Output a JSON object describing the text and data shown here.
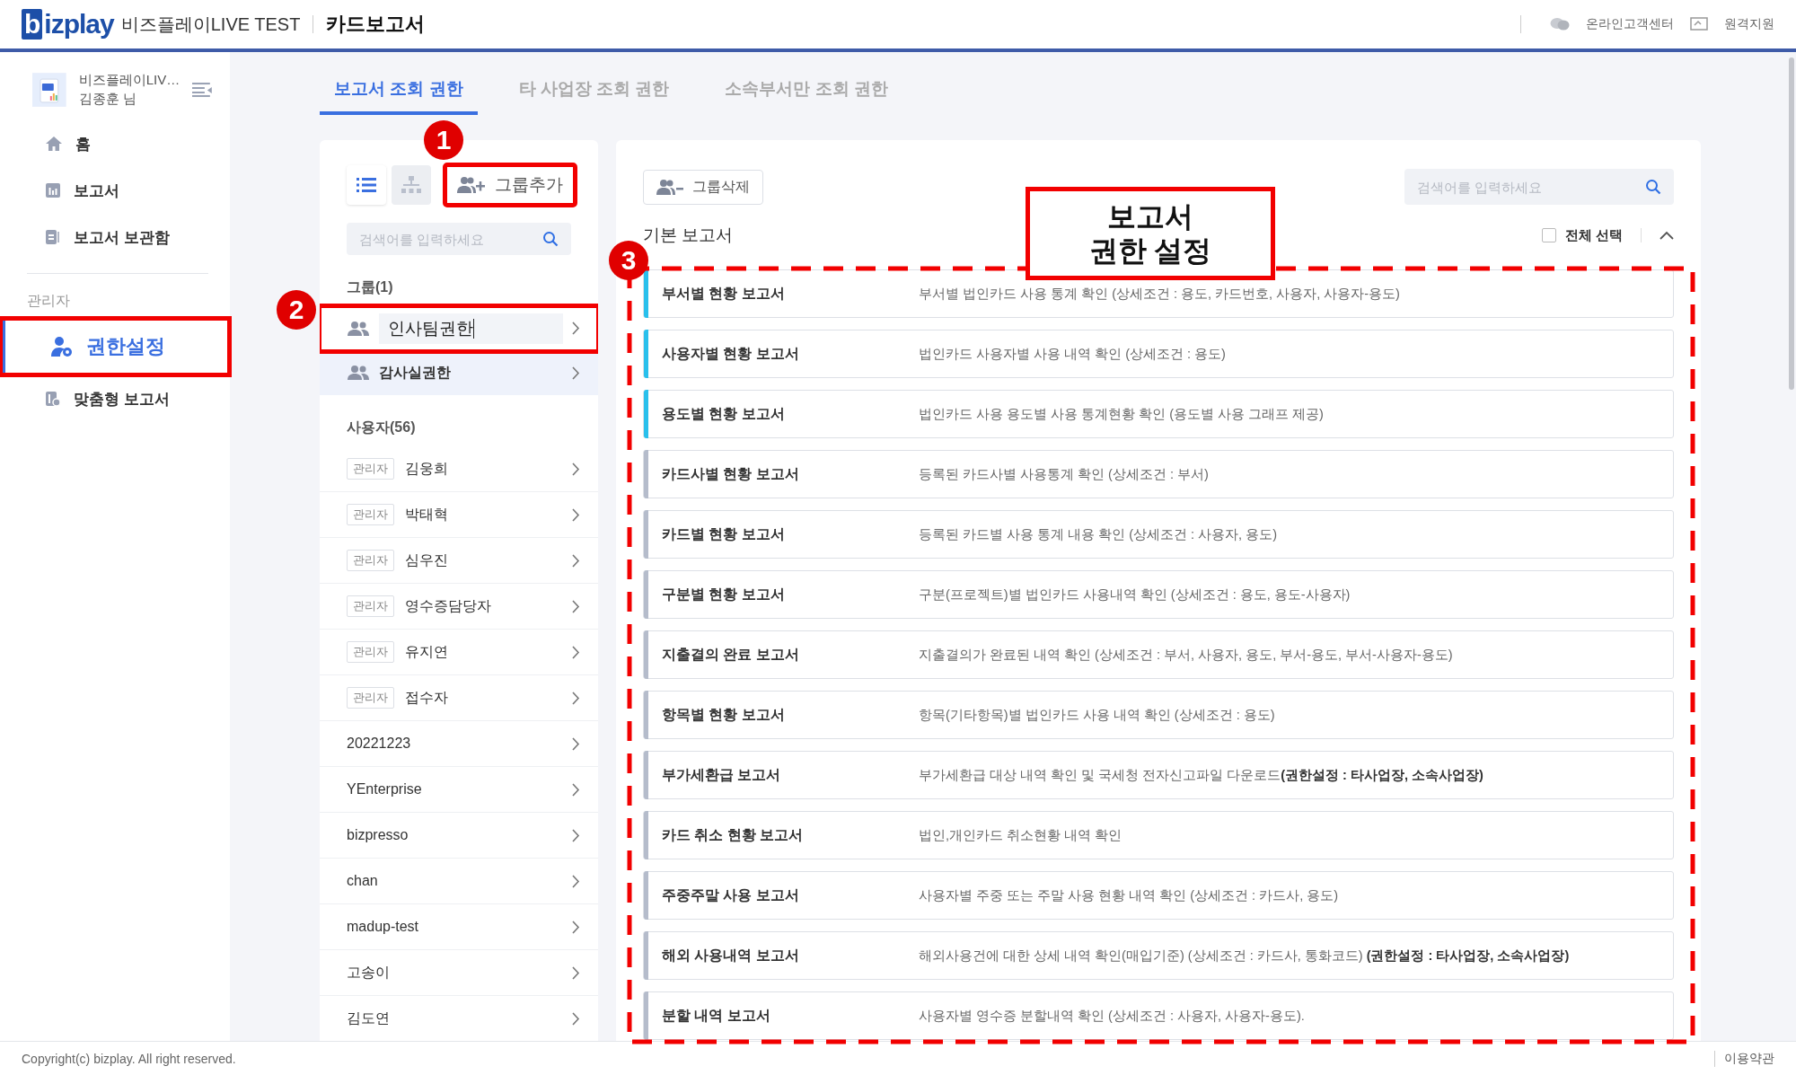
{
  "header": {
    "logo": "bizplay",
    "company": "비즈플레이LIVE TEST",
    "title": "카드보고서",
    "links": [
      {
        "kind": "chat",
        "label": "온라인고객센터"
      },
      {
        "kind": "remote",
        "label": "원격지원"
      }
    ]
  },
  "sidebar": {
    "profile": {
      "company": "비즈플레이LIV…",
      "user": "김종훈 님"
    },
    "items": [
      {
        "kind": "home",
        "label": "홈",
        "selected": false
      },
      {
        "kind": "chart",
        "label": "보고서",
        "selected": false
      },
      {
        "kind": "archive",
        "label": "보고서 보관함",
        "selected": false
      }
    ],
    "section": "관리자",
    "admin_items": [
      {
        "kind": "permission",
        "label": "권한설정",
        "selected": true,
        "annotated": true
      },
      {
        "kind": "custom",
        "label": "맞춤형 보고서",
        "selected": false
      }
    ]
  },
  "tabs": [
    {
      "label": "보고서 조회 권한",
      "selected": true
    },
    {
      "label": "타 사업장 조회 권한",
      "selected": false
    },
    {
      "label": "소속부서만 조회 권한",
      "selected": false
    }
  ],
  "left_panel": {
    "views": [
      {
        "kind": "list",
        "selected": true
      },
      {
        "kind": "tree",
        "selected": false
      }
    ],
    "add_button": {
      "label": "그룹추가",
      "annotated": true
    },
    "search": {
      "placeholder": "검색어를 입력하세요"
    },
    "groups_heading": "그룹(1)",
    "groups": [
      {
        "label": "인사팀권한",
        "editing": true,
        "selected": false,
        "annotated": true
      },
      {
        "label": "감사실권한",
        "editing": false,
        "selected": true
      }
    ],
    "users_heading": "사용자(56)",
    "users": [
      {
        "tag": "관리자",
        "name": "김웅희"
      },
      {
        "tag": "관리자",
        "name": "박태혁"
      },
      {
        "tag": "관리자",
        "name": "심우진"
      },
      {
        "tag": "관리자",
        "name": "영수증담당자"
      },
      {
        "tag": "관리자",
        "name": "유지연"
      },
      {
        "tag": "관리자",
        "name": "접수자"
      },
      {
        "name": "20221223"
      },
      {
        "name": "YEnterprise"
      },
      {
        "name": "bizpresso"
      },
      {
        "name": "chan"
      },
      {
        "name": "madup-test"
      },
      {
        "name": "고송이"
      },
      {
        "name": "김도연"
      }
    ]
  },
  "right_panel": {
    "delete_button": "그룹삭제",
    "search": {
      "placeholder": "검색어를 입력하세요"
    },
    "section": "기본 보고서",
    "select_all": {
      "label": "전체 선택",
      "checked": false
    },
    "expanded": true,
    "reports": [
      {
        "name": "부서별 현황 보고서",
        "description": "부서별 법인카드 사용 통계 확인 (상세조건 : 용도, 카드번호, 사용자, 사용자-용도)",
        "selected": true
      },
      {
        "name": "사용자별 현황 보고서",
        "description": "법인카드 사용자별 사용 내역 확인 (상세조건 : 용도)",
        "selected": true
      },
      {
        "name": "용도별 현황 보고서",
        "description": "법인카드 사용 용도별 사용 통계현황 확인 (용도별 사용 그래프 제공)",
        "selected": true
      },
      {
        "name": "카드사별 현황 보고서",
        "description": "등록된 카드사별 사용통계 확인 (상세조건 : 부서)",
        "selected": false
      },
      {
        "name": "카드별 현황 보고서",
        "description": "등록된 카드별 사용 통계 내용 확인 (상세조건 : 사용자, 용도)",
        "selected": false
      },
      {
        "name": "구분별 현황 보고서",
        "description": "구분(프로젝트)별 법인카드 사용내역 확인 (상세조건 : 용도, 용도-사용자)",
        "selected": false
      },
      {
        "name": "지출결의 완료 보고서",
        "description": "지출결의가 완료된 내역 확인 (상세조건 : 부서, 사용자, 용도, 부서-용도, 부서-사용자-용도)",
        "selected": false
      },
      {
        "name": "항목별 현황 보고서",
        "description": "항목(기타항목)별 법인카드 사용 내역 확인 (상세조건 : 용도)",
        "selected": false
      },
      {
        "name": "부가세환급 보고서",
        "description": "부가세환급 대상 내역 확인 및 국세청 전자신고파일 다운로드**(권한설정 : 타사업장, 소속사업장)**",
        "selected": false
      },
      {
        "name": "카드 취소 현황 보고서",
        "description": "법인,개인카드 취소현황 내역 확인",
        "selected": false
      },
      {
        "name": "주중주말 사용 보고서",
        "description": "사용자별 주중 또는 주말 사용 현황 내역 확인 (상세조건 : 카드사, 용도)",
        "selected": false
      },
      {
        "name": "해외 사용내역 보고서",
        "description": "해외사용건에 대한 상세 내역 확인(매입기준) (상세조건 : 카드사, 통화코드) **(권한설정 : 타사업장, 소속사업장)**",
        "selected": false
      },
      {
        "name": "분할 내역 보고서",
        "description": "사용자별 영수증 분할내역 확인 (상세조건 : 사용자, 사용자-용도).",
        "selected": false
      }
    ]
  },
  "footer": {
    "copyright": "Copyright(c) bizplay. All right reserved.",
    "terms": "이용약관"
  },
  "annotations": [
    {
      "kind": "badge",
      "label": "1"
    },
    {
      "kind": "badge",
      "label": "2"
    },
    {
      "kind": "badge",
      "label": "3"
    },
    {
      "kind": "callout",
      "lines": [
        "보고서",
        "권한 설정"
      ]
    }
  ]
}
